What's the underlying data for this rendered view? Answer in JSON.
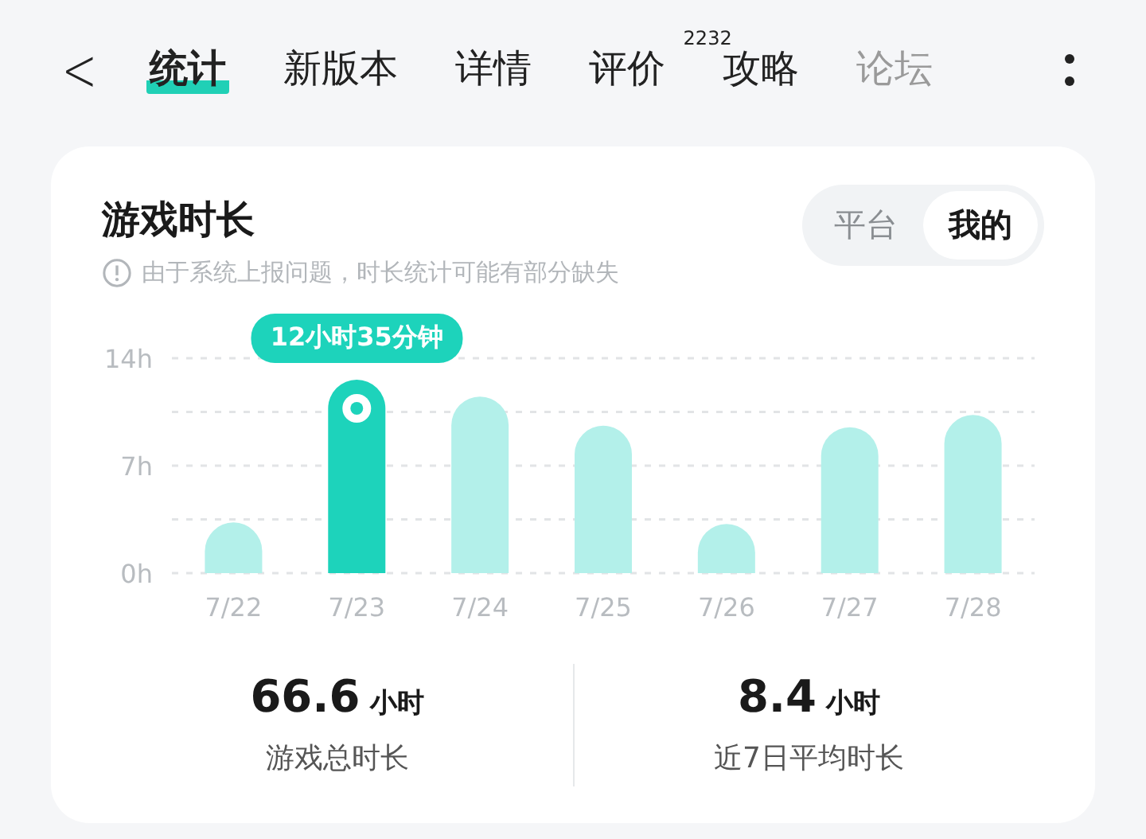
{
  "nav": {
    "back": "<",
    "tabs": [
      {
        "label": "统计",
        "selected": true
      },
      {
        "label": "新版本",
        "selected": false
      },
      {
        "label": "详情",
        "selected": false
      },
      {
        "label": "评价",
        "selected": false,
        "badge": "2232"
      },
      {
        "label": "攻略",
        "selected": false
      },
      {
        "label": "论坛",
        "selected": false,
        "faded": true
      }
    ]
  },
  "card": {
    "title": "游戏时长",
    "notice": "由于系统上报问题，时长统计可能有部分缺失",
    "toggle": [
      {
        "label": "平台",
        "selected": false
      },
      {
        "label": "我的",
        "selected": true
      }
    ],
    "chart_data": {
      "type": "bar",
      "categories": [
        "7/22",
        "7/23",
        "7/24",
        "7/25",
        "7/26",
        "7/27",
        "7/28"
      ],
      "series": [
        {
          "color": "#b3f0ea",
          "values": [
            3.3,
            null,
            11.5,
            9.6,
            3.2,
            9.5,
            10.3
          ]
        },
        {
          "color": "#1dd3bb",
          "values": [
            null,
            12.6,
            null,
            null,
            null,
            null,
            null
          ]
        }
      ],
      "ylim": [
        0,
        14
      ],
      "yticks": [
        {
          "value": 0,
          "label": "0h"
        },
        {
          "value": 7,
          "label": "7h"
        },
        {
          "value": 14,
          "label": "14h"
        }
      ],
      "annotations": [
        "12小时35分钟"
      ]
    },
    "stats": [
      {
        "value": "66.6",
        "unit": "小时",
        "label": "游戏总时长"
      },
      {
        "value": "8.4",
        "unit": "小时",
        "label": "近7日平均时长"
      }
    ]
  }
}
